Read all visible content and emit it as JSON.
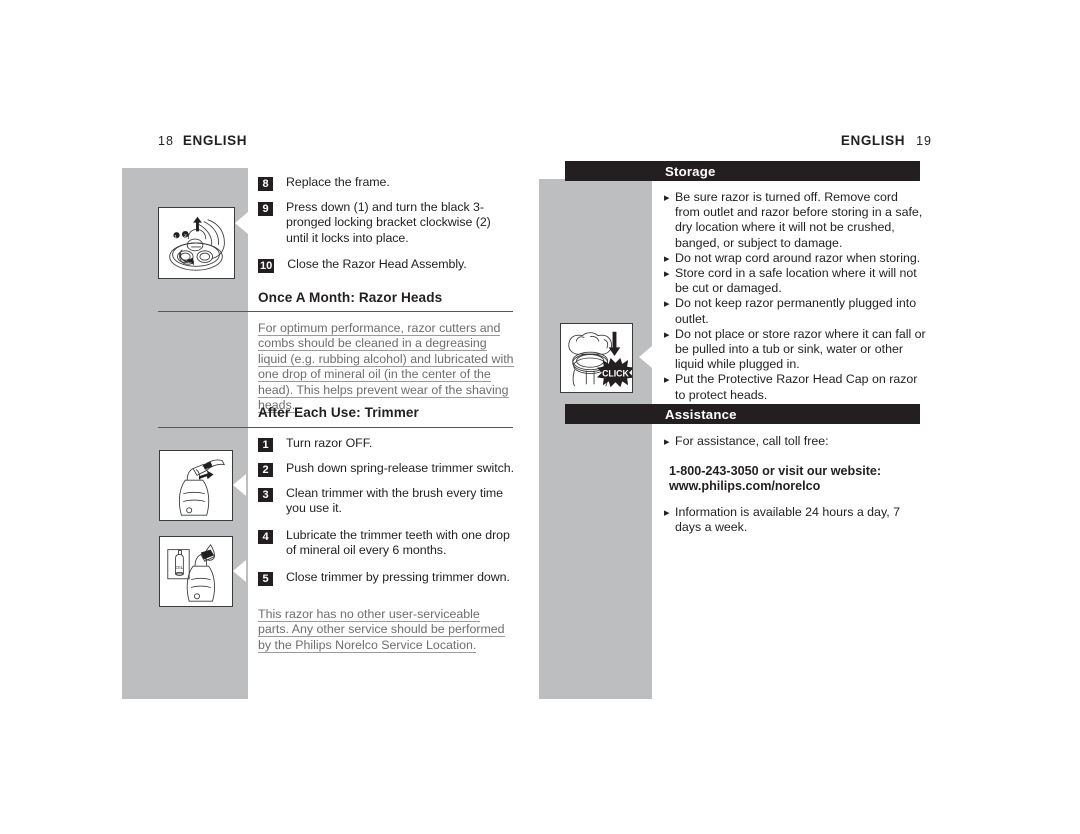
{
  "document": {
    "type": "product-manual-spread",
    "language": "ENGLISH"
  },
  "colors": {
    "grey_panel": "#bcbec0",
    "banner_black": "#231f20",
    "note_grey": "#6d6e71",
    "rule_grey": "#58595b",
    "paper_white": "#ffffff"
  },
  "left_page": {
    "running_head": {
      "folio": "18",
      "word": "ENGLISH"
    },
    "steps_razor_head": [
      {
        "num": "8",
        "text": "Replace the frame."
      },
      {
        "num": "9",
        "text": "Press down (1) and turn the black 3-pronged locking bracket clockwise (2) until it locks into place."
      },
      {
        "num": "10",
        "text": "Close the Razor Head Assembly."
      }
    ],
    "section_once_a_month": {
      "heading": "Once A Month:  Razor Heads",
      "note": "For optimum performance, razor cutters and combs should be cleaned in a degreasing liquid (e.g. rubbing alcohol) and lubricated with one drop of mineral oil (in the center of the head). This helps prevent wear of the shaving heads."
    },
    "section_after_each_use": {
      "heading": "After Each Use:  Trimmer",
      "steps": [
        {
          "num": "1",
          "text": "Turn razor OFF."
        },
        {
          "num": "2",
          "text": "Push down spring-release trimmer switch."
        },
        {
          "num": "3",
          "text": "Clean trimmer with the brush every time you use it."
        },
        {
          "num": "4",
          "text": "Lubricate the trimmer teeth with one drop of mineral oil every 6 months."
        },
        {
          "num": "5",
          "text": "Close trimmer by pressing trimmer down."
        }
      ],
      "note": "This razor has no other user-serviceable parts. Any other service should be performed by the Philips Norelco Service Location."
    },
    "figures": [
      {
        "name": "razor-head-locking-bracket-figure",
        "caption_labels": [
          "1",
          "2"
        ]
      },
      {
        "name": "trimmer-brush-cleaning-figure",
        "caption_labels": []
      },
      {
        "name": "trimmer-oil-lubrication-figure",
        "caption_labels": []
      }
    ]
  },
  "right_page": {
    "running_head": {
      "folio": "19",
      "word": "ENGLISH"
    },
    "storage": {
      "banner": "Storage",
      "bullets": [
        "Be sure razor is turned off. Remove cord from outlet and razor before storing in a safe, dry location where it will not be crushed, banged, or subject to damage.",
        "Do not wrap cord around razor when storing.",
        "Store cord in a safe location where it will not be cut or damaged.",
        "Do not keep razor permanently plugged into outlet.",
        "Do not place or store razor where it can fall or be pulled into a tub or sink, water or other liquid while plugged in.",
        "Put the Protective Razor Head Cap on razor to protect heads."
      ]
    },
    "assistance": {
      "banner": "Assistance",
      "bullet_intro": "For assistance, call toll free:",
      "contact_line_1": "1-800-243-3050 or visit our website:",
      "contact_line_2": "www.philips.com/norelco",
      "bullet_hours": "Information is available 24 hours a day, 7 days a week."
    },
    "figures": [
      {
        "name": "protective-razor-head-cap-figure",
        "callout": "CLICK"
      }
    ]
  },
  "icons": {
    "bullet_marker": "half-moon-bullet",
    "figure_pointer": "left-triangle-pointer"
  }
}
